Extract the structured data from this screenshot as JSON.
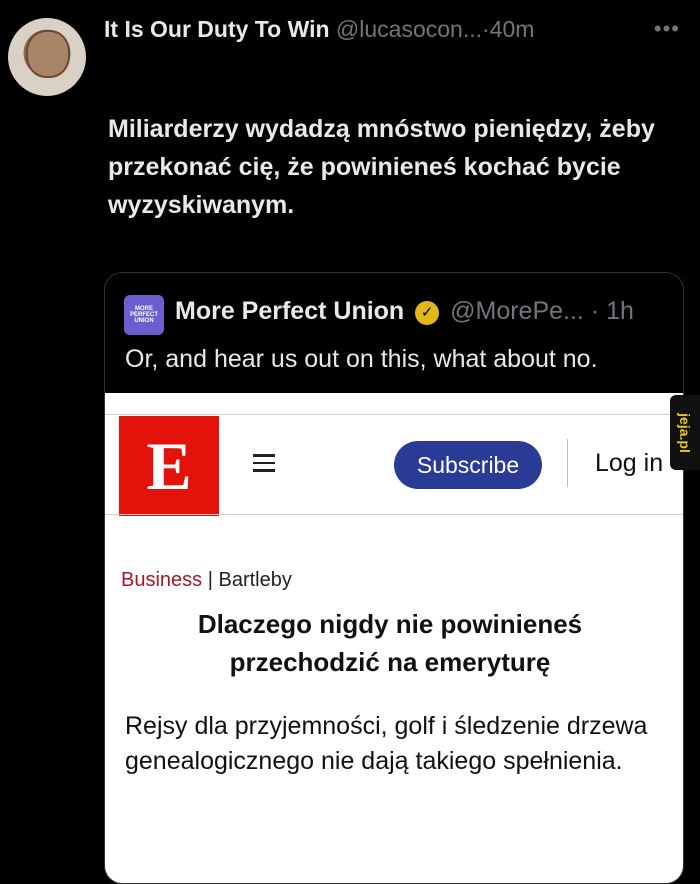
{
  "tweet": {
    "display_name": "It Is Our Duty To Win",
    "handle": "@lucasocon...",
    "separator": "·",
    "time": "40m",
    "more_icon": "more-icon",
    "text": "Miliarderzy wydadzą mnóstwo pieniędzy, żeby przekonać cię, że powinieneś kochać bycie wyzyskiwanym."
  },
  "quote": {
    "display_name": "More Perfect Union",
    "verified_icon": "verified-badge-icon",
    "handle": "@MorePe...",
    "separator": "·",
    "time": "1h",
    "text": "Or, and hear us out on this, what about no.",
    "avatar_label": "MORE PERFECT UNION"
  },
  "article": {
    "logo_letter": "E",
    "subscribe_label": "Subscribe",
    "login_label": "Log in",
    "section": "Business",
    "section_separator": "|",
    "column": "Bartleby",
    "headline": "Dlaczego nigdy nie powinieneś przechodzić na emeryturę",
    "summary": "Rejsy dla przyjemności, golf i śledzenie drzewa genealogicznego nie dają takiego spełnienia."
  },
  "watermark": {
    "text": "jeja.pl"
  },
  "colors": {
    "background": "#000000",
    "text": "#e7e9ea",
    "muted": "#71767b",
    "economist_red": "#e3120b",
    "subscribe_blue": "#2a3b95",
    "section_red": "#a4182a",
    "verified_gold": "#e2b719"
  }
}
